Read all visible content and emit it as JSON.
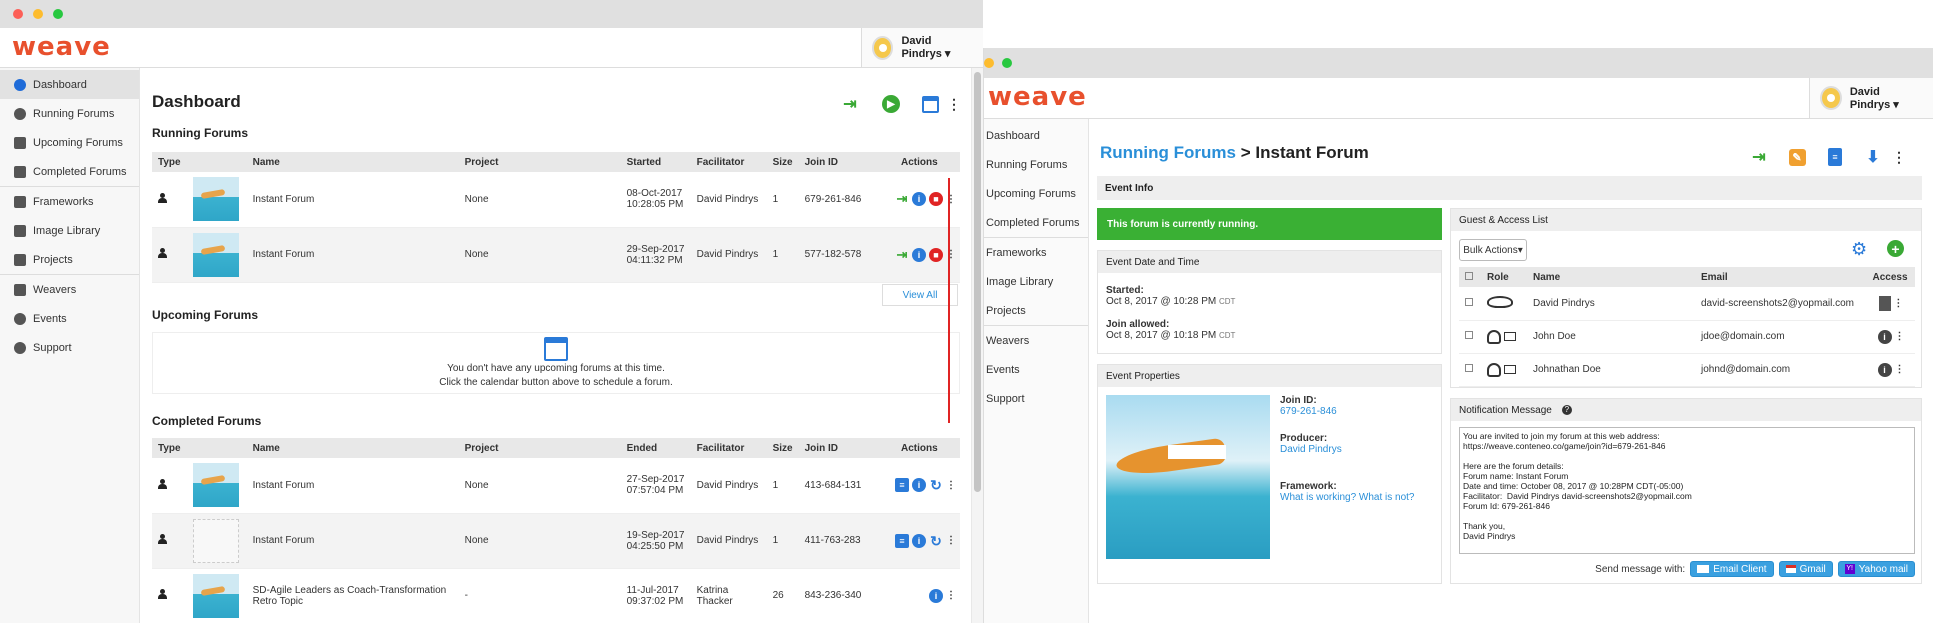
{
  "left_window": {
    "brand": "weave",
    "user_name": "David Pindrys ▾",
    "sidebar": [
      {
        "label": "Dashboard"
      },
      {
        "label": "Running Forums"
      },
      {
        "label": "Upcoming Forums"
      },
      {
        "label": "Completed Forums"
      },
      {
        "label": "Frameworks"
      },
      {
        "label": "Image Library"
      },
      {
        "label": "Projects"
      },
      {
        "label": "Weavers"
      },
      {
        "label": "Events"
      },
      {
        "label": "Support"
      }
    ],
    "page_title": "Dashboard",
    "running": {
      "title": "Running Forums",
      "columns": [
        "Type",
        "Name",
        "Project",
        "Started",
        "Facilitator",
        "Size",
        "Join ID",
        "Actions"
      ],
      "rows": [
        {
          "name": "Instant Forum",
          "project": "None",
          "date": "08-Oct-2017",
          "time": "10:28:05 PM",
          "facilitator": "David Pindrys",
          "size": "1",
          "join_id": "679-261-846"
        },
        {
          "name": "Instant Forum",
          "project": "None",
          "date": "29-Sep-2017",
          "time": "04:11:32 PM",
          "facilitator": "David Pindrys",
          "size": "1",
          "join_id": "577-182-578"
        }
      ],
      "view_all": "View All"
    },
    "upcoming": {
      "title": "Upcoming Forums",
      "empty_line1": "You don't have any upcoming forums at this time.",
      "empty_line2": "Click the calendar button above to schedule a forum."
    },
    "completed": {
      "title": "Completed Forums",
      "columns": [
        "Type",
        "Name",
        "Project",
        "Ended",
        "Facilitator",
        "Size",
        "Join ID",
        "Actions"
      ],
      "rows": [
        {
          "name": "Instant Forum",
          "project": "None",
          "date": "27-Sep-2017",
          "time": "07:57:04 PM",
          "facilitator": "David Pindrys",
          "size": "1",
          "join_id": "413-684-131"
        },
        {
          "name": "Instant Forum",
          "project": "None",
          "date": "19-Sep-2017",
          "time": "04:25:50 PM",
          "facilitator": "David Pindrys",
          "size": "1",
          "join_id": "411-763-283"
        },
        {
          "name": "SD-Agile Leaders as Coach-Transformation Retro Topic",
          "project": "-",
          "date": "11-Jul-2017",
          "time": "09:37:02 PM",
          "facilitator": "Katrina Thacker",
          "size": "26",
          "join_id": "843-236-340"
        }
      ]
    }
  },
  "right_window": {
    "brand": "weave",
    "user_name": "David Pindrys ▾",
    "sidebar": [
      {
        "label": "Dashboard"
      },
      {
        "label": "Running Forums"
      },
      {
        "label": "Upcoming Forums"
      },
      {
        "label": "Completed Forums"
      },
      {
        "label": "Frameworks"
      },
      {
        "label": "Image Library"
      },
      {
        "label": "Projects"
      },
      {
        "label": "Weavers"
      },
      {
        "label": "Events"
      },
      {
        "label": "Support"
      }
    ],
    "breadcrumb_link": "Running Forums",
    "breadcrumb_sep": ">",
    "breadcrumb_current": "Instant Forum",
    "event_info": "Event Info",
    "running_banner": "This forum is currently running.",
    "date_time": {
      "title": "Event Date and Time",
      "started_label": "Started:",
      "started_value": "Oct 8, 2017 @ 10:28 PM",
      "tz": "CDT",
      "join_label": "Join allowed:",
      "join_value": "Oct 8, 2017 @ 10:18 PM"
    },
    "properties": {
      "title": "Event Properties",
      "join_id_label": "Join ID:",
      "join_id": "679-261-846",
      "producer_label": "Producer:",
      "producer": "David Pindrys",
      "framework_label": "Framework:",
      "framework": "What is working? What is not?"
    },
    "guests": {
      "title": "Guest & Access List",
      "bulk_actions": "Bulk Actions▾",
      "columns": [
        "Role",
        "Name",
        "Email",
        "Access"
      ],
      "rows": [
        {
          "name": "David Pindrys",
          "email": "david-screenshots2@yopmail.com"
        },
        {
          "name": "John Doe",
          "email": "jdoe@domain.com"
        },
        {
          "name": "Johnathan Doe",
          "email": "johnd@domain.com"
        }
      ]
    },
    "notification": {
      "title": "Notification Message",
      "help": "?",
      "message": "You are invited to join my forum at this web address:\nhttps://weave.conteneo.co/game/join?id=679-261-846\n\nHere are the forum details:\nForum name: Instant Forum\nDate and time: October 08, 2017 @ 10:28PM CDT(-05:00)\nFacilitator:  David Pindrys david-screenshots2@yopmail.com\nForum Id: 679-261-846\n\nThank you,\nDavid Pindrys",
      "send_label": "Send message with:",
      "email_client": "Email Client",
      "gmail": "Gmail",
      "yahoo": "Yahoo mail"
    }
  },
  "colors": {
    "brand": "#e8502d",
    "green": "#3aa935",
    "blue": "#2a7ad8",
    "red": "#e02424",
    "link": "#2a8fd8"
  }
}
